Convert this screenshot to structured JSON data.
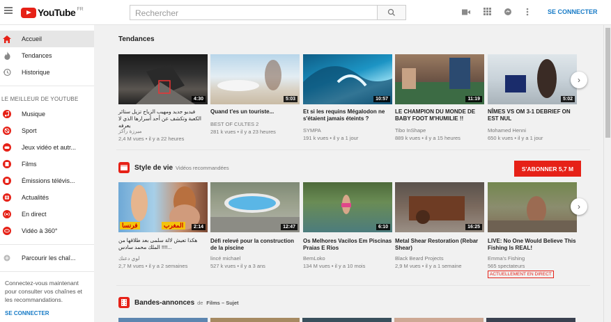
{
  "header": {
    "logo_text": "YouTube",
    "logo_region": "FR",
    "search_placeholder": "Rechercher",
    "connect_label": "SE CONNECTER"
  },
  "sidebar": {
    "items": [
      {
        "label": "Accueil"
      },
      {
        "label": "Tendances"
      },
      {
        "label": "Historique"
      }
    ],
    "best_heading": "LE MEILLEUR DE YOUTUBE",
    "best_items": [
      {
        "label": "Musique"
      },
      {
        "label": "Sport"
      },
      {
        "label": "Jeux vidéo et autr..."
      },
      {
        "label": "Films"
      },
      {
        "label": "Émissions télévis..."
      },
      {
        "label": "Actualités"
      },
      {
        "label": "En direct"
      },
      {
        "label": "Vidéo à 360°"
      }
    ],
    "browse_label": "Parcourir les chaî...",
    "note": "Connectez-vous maintenant pour consulter vos chaînes et les recommandations.",
    "connect_label": "SE CONNECTER"
  },
  "sections": {
    "trending": {
      "title": "Tendances",
      "videos": [
        {
          "title": "فيديو جديد ومهيب الزياح تزيل ستائر الكعبة وتكشف عن أحد أسرارها الذي لا يعرفه",
          "channel": "ميرزة راكز",
          "meta": "2,4 M vues • il y a 22 heures",
          "duration": "4:30"
        },
        {
          "title": "Quand t'es un touriste...",
          "channel": "BEST OF CULTES 2",
          "meta": "281 k vues • il y a 23 heures",
          "duration": "5:03"
        },
        {
          "title": "Et si les requins Mégalodon ne s'étaient jamais éteints ?",
          "channel": "SYMPA",
          "meta": "191 k vues • il y a 1 jour",
          "duration": "10:57"
        },
        {
          "title": "LE CHAMPION DU MONDE DE BABY FOOT M'HUMILIE !!",
          "channel": "Tibo InShape",
          "meta": "889 k vues • il y a 15 heures",
          "duration": "11:19"
        },
        {
          "title": "NÎMES VS OM 3-1 DEBRIEF ON EST NUL",
          "channel": "Mohamed Henni",
          "meta": "650 k vues • il y a 1 jour",
          "duration": "5:02"
        }
      ]
    },
    "lifestyle": {
      "title": "Style de vie",
      "subtitle": "Vidéos recommandées",
      "subscribe_label": "S'ABONNER 5,7 M",
      "videos": [
        {
          "title": "هكذا تعيش لالة سلمى بعد طلاقها من ...!!!! الملك محمد سادس",
          "channel": "لوي دعنك",
          "meta": "2,7 M vues • il y a 2 semaines",
          "duration": "2:14",
          "overlay_left": "فرنسا",
          "overlay_right": "المغرب"
        },
        {
          "title": "Défi relevé pour la construction de la piscine",
          "channel": "lincé michael",
          "meta": "527 k vues • il y a 3 ans",
          "duration": "12:47"
        },
        {
          "title": "Os Melhores Vacilos Em Piscinas Praias E Rios",
          "channel": "BemLoko",
          "meta": "134 M vues • il y a 10 mois",
          "duration": "6:10"
        },
        {
          "title": "Metal Shear Restoration (Rebar Shear)",
          "channel": "Black Beard Projects",
          "meta": "2,9 M vues • il y a 1 semaine",
          "duration": "16:25"
        },
        {
          "title": "LIVE: No One Would Believe This Fishing Is REAL!",
          "channel": "Emma's Fishing",
          "meta": "565 spectateurs",
          "live_label": "ACTUELLEMENT EN DIRECT"
        }
      ]
    },
    "trailers": {
      "title": "Bandes-annonces",
      "subtitle_prefix": "de",
      "subtitle_bold": "Films – Sujet"
    }
  },
  "colors": {
    "brand_red": "#e62117",
    "link_blue": "#167ac6"
  }
}
